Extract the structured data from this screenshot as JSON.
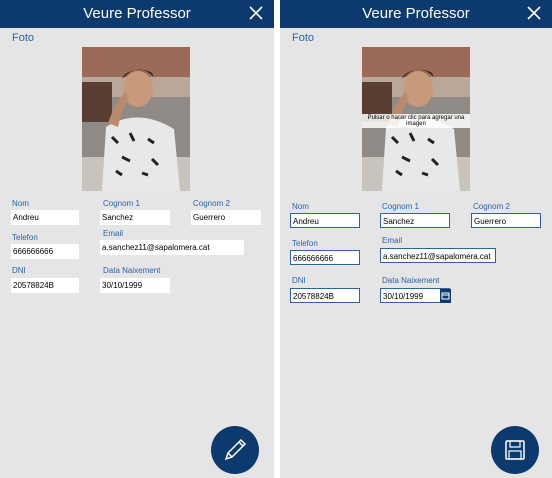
{
  "view_panel": {
    "title": "Veure Professor",
    "foto_label": "Foto",
    "fields": {
      "nom": {
        "label": "Nom",
        "value": "Andreu"
      },
      "cognom1": {
        "label": "Cognom 1",
        "value": "Sanchez"
      },
      "cognom2": {
        "label": "Cognom 2",
        "value": "Guerrero"
      },
      "telefon": {
        "label": "Telefon",
        "value": "666666666"
      },
      "email": {
        "label": "Email",
        "value": "a.sanchez11@sapalomera.cat"
      },
      "dni": {
        "label": "DNI",
        "value": "20578824B"
      },
      "data": {
        "label": "Data Naixement",
        "value": "30/10/1999"
      }
    },
    "fab_icon": "pencil-icon"
  },
  "edit_panel": {
    "title": "Veure Professor",
    "foto_label": "Foto",
    "photo_hint": "Pulsar o hacer clic para agregar una imagen",
    "fields": {
      "nom": {
        "label": "Nom",
        "value": "Andreu"
      },
      "cognom1": {
        "label": "Cognom 1",
        "value": "Sanchez"
      },
      "cognom2": {
        "label": "Cognom 2",
        "value": "Guerrero"
      },
      "telefon": {
        "label": "Telefon",
        "value": "666666666"
      },
      "email": {
        "label": "Email",
        "value": "a.sanchez11@sapalomera.cat"
      },
      "dni": {
        "label": "DNI",
        "value": "20578824B"
      },
      "data": {
        "label": "Data Naixement",
        "value": "30/10/1999"
      }
    },
    "fab_icon": "save-floppy-icon",
    "date_icon": "calendar-icon"
  },
  "colors": {
    "header": "#0d3a6e",
    "label": "#2b63a6",
    "panel_bg": "#e5e5e5"
  }
}
